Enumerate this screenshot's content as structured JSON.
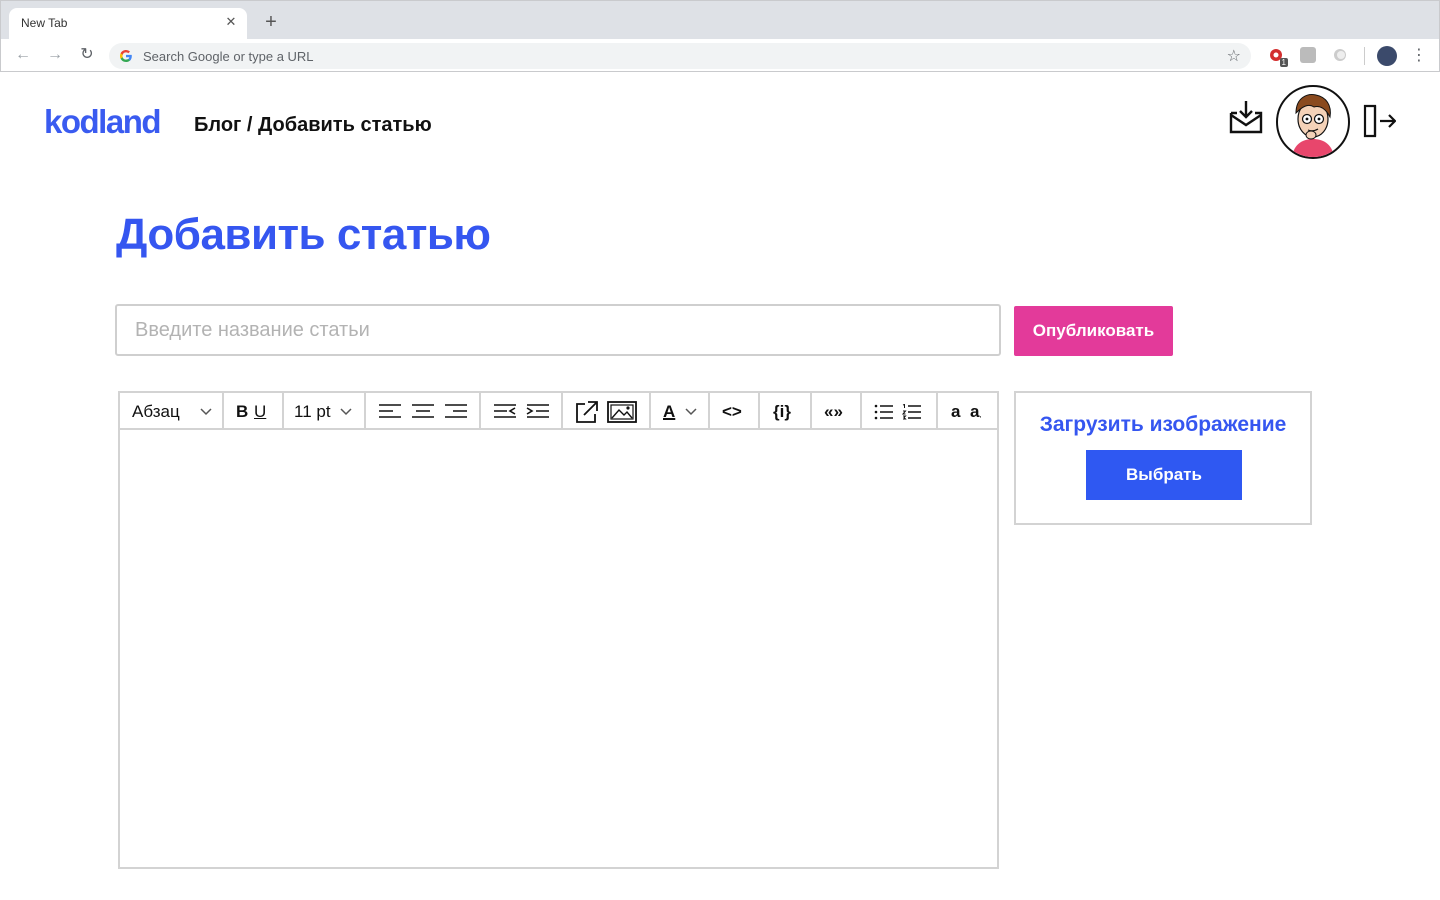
{
  "browser": {
    "tab_title": "New Tab",
    "tab_close": "✕",
    "new_tab": "+",
    "omnibox_placeholder": "Search Google or type a URL",
    "extension_badge": "1"
  },
  "site": {
    "logo": "kodland",
    "breadcrumb": "Блог / Добавить статью",
    "colors": {
      "brand_blue": "#3556f0",
      "publish_pink": "#e33a9a",
      "button_blue": "#2f58f2"
    }
  },
  "main": {
    "page_title": "Добавить статью",
    "title_placeholder": "Введите название статьи",
    "publish_label": "Опубликовать",
    "toolbar": {
      "paragraph_style": "Абзац",
      "bold": "B",
      "underline": "U",
      "font_size": "11 pt",
      "text_color": "A",
      "code": "<>",
      "code_block": "{i}",
      "quote": "«»",
      "lowercase": "a",
      "subscript": "a"
    },
    "upload": {
      "title": "Загрузить изображение",
      "choose_label": "Выбрать"
    }
  }
}
